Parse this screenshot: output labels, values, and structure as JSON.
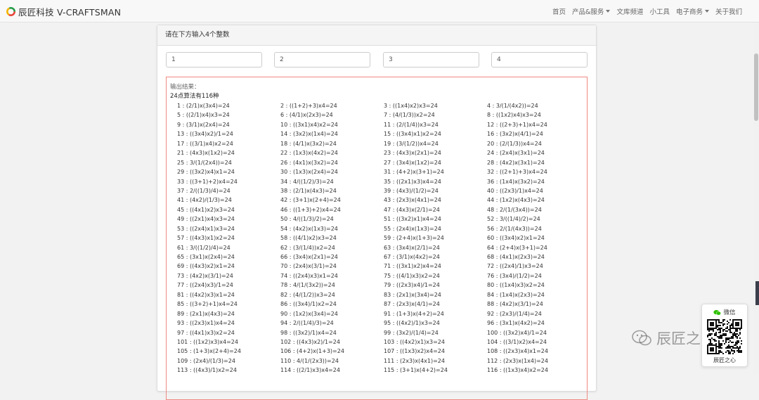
{
  "brand": {
    "title": "辰匠科技 V-CRAFTSMAN"
  },
  "nav": {
    "items": [
      {
        "label": "首页",
        "dropdown": false
      },
      {
        "label": "产品&服务",
        "dropdown": true
      },
      {
        "label": "文库频道",
        "dropdown": false
      },
      {
        "label": "小工具",
        "dropdown": false
      },
      {
        "label": "电子商务",
        "dropdown": true
      },
      {
        "label": "关于我们",
        "dropdown": false
      }
    ]
  },
  "panel": {
    "heading": "请在下方输入4个整数"
  },
  "inputs": {
    "values": [
      "1",
      "2",
      "3",
      "4"
    ]
  },
  "result": {
    "label": "输出结果：",
    "count_text": "24点算法有116种",
    "solutions": [
      "1 : (2/1)x(3x4)=24",
      "2 : ((1+2)+3)x4=24",
      "3 : ((1x4)x2)x3=24",
      "4 : 3/(1/(4x2))=24",
      "5 : ((2/1)x4)x3=24",
      "6 : (4/1)x(2x3)=24",
      "7 : (4/(1/3))x2=24",
      "8 : ((1x2)x4)x3=24",
      "9 : (3/1)x(2x4)=24",
      "10 : ((3x1)x4)x2=24",
      "11 : (2/(1/4))x3=24",
      "12 : ((2+3)+1)x4=24",
      "13 : ((3x4)x2)/1=24",
      "14 : (3x2)x(1x4)=24",
      "15 : ((3x4)x1)x2=24",
      "16 : (3x2)x(4/1)=24",
      "17 : ((3/1)x4)x2=24",
      "18 : (4/1)x(3x2)=24",
      "19 : (3/(1/2))x4=24",
      "20 : (2/(1/3))x4=24",
      "21 : (4x3)x(1x2)=24",
      "22 : (1x3)x(4x2)=24",
      "23 : (4x3)x(2x1)=24",
      "24 : (2x4)x(3x1)=24",
      "25 : 3/(1/(2x4))=24",
      "26 : (4x1)x(3x2)=24",
      "27 : (3x4)x(1x2)=24",
      "28 : (4x2)x(3x1)=24",
      "29 : ((3x2)x4)x1=24",
      "30 : (1x3)x(2x4)=24",
      "31 : (4+2)x(3+1)=24",
      "32 : ((2+1)+3)x4=24",
      "33 : ((3+1)+2)x4=24",
      "34 : 4/((1/2)/3)=24",
      "35 : ((2x1)x3)x4=24",
      "36 : (1x4)x(3x2)=24",
      "37 : 2/((1/3)/4)=24",
      "38 : (2/1)x(4x3)=24",
      "39 : (4x3)/(1/2)=24",
      "40 : ((2x3)/1)x4=24",
      "41 : (4x2)/(1/3)=24",
      "42 : (3+1)x(2+4)=24",
      "43 : (2x3)x(4x1)=24",
      "44 : (1x2)x(4x3)=24",
      "45 : ((4x1)x2)x3=24",
      "46 : ((1+3)+2)x4=24",
      "47 : (4x3)x(2/1)=24",
      "48 : 2/(1/(3x4))=24",
      "49 : ((2x1)x4)x3=24",
      "50 : 4/((1/3)/2)=24",
      "51 : ((3x2)x1)x4=24",
      "52 : 3/((1/4)/2)=24",
      "53 : ((2x4)x1)x3=24",
      "54 : (4x2)x(1x3)=24",
      "55 : (2x4)x(1x3)=24",
      "56 : 2/(1/(4x3))=24",
      "57 : ((4x3)x1)x2=24",
      "58 : ((4/1)x2)x3=24",
      "59 : (2+4)x(1+3)=24",
      "60 : ((3x4)x2)x1=24",
      "61 : 3/((1/2)/4)=24",
      "62 : (3/(1/4))x2=24",
      "63 : (3x4)x(2/1)=24",
      "64 : (2+4)x(3+1)=24",
      "65 : (3x1)x(2x4)=24",
      "66 : (3x4)x(2x1)=24",
      "67 : (3/1)x(4x2)=24",
      "68 : (4x1)x(2x3)=24",
      "69 : ((4x3)x2)x1=24",
      "70 : (2x4)x(3/1)=24",
      "71 : ((3x1)x2)x4=24",
      "72 : ((2x4)/1)x3=24",
      "73 : (4x2)x(3/1)=24",
      "74 : ((2x4)x3)x1=24",
      "75 : ((4/1)x3)x2=24",
      "76 : (3x4)/(1/2)=24",
      "77 : ((2x4)x3)/1=24",
      "78 : 4/(1/(3x2))=24",
      "79 : ((2x3)x4)/1=24",
      "80 : ((1x4)x3)x2=24",
      "81 : ((4x2)x3)x1=24",
      "82 : (4/(1/2))x3=24",
      "83 : (2x1)x(3x4)=24",
      "84 : (1x4)x(2x3)=24",
      "85 : ((3+2)+1)x4=24",
      "86 : ((3x4)/1)x2=24",
      "87 : (2x3)x(4/1)=24",
      "88 : (4x2)x(3/1)=24",
      "89 : (2x1)x(4x3)=24",
      "90 : (1x2)x(3x4)=24",
      "91 : (1+3)x(4+2)=24",
      "92 : (2x3)/(1/4)=24",
      "93 : ((2x3)x1)x4=24",
      "94 : 2/((1/4)/3)=24",
      "95 : ((4x2)/1)x3=24",
      "96 : (3x1)x(4x2)=24",
      "97 : ((4x1)x3)x2=24",
      "98 : ((3x2)/1)x4=24",
      "99 : (3x2)/(1/4)=24",
      "100 : ((3x2)x4)/1=24",
      "101 : ((1x2)x3)x4=24",
      "102 : ((4x3)x2)/1=24",
      "103 : ((4x2)x1)x3=24",
      "104 : ((3/1)x2)x4=24",
      "105 : (1+3)x(2+4)=24",
      "106 : (4+2)x(1+3)=24",
      "107 : ((1x3)x2)x4=24",
      "108 : ((2x3)x4)x1=24",
      "109 : (2x4)/(1/3)=24",
      "110 : 4/(1/(2x3))=24",
      "111 : (2x3)x(4x1)=24",
      "112 : (2x3)x(1x4)=24",
      "113 : ((4x3)/1)x2=24",
      "114 : ((2/1)x3)x4=24",
      "115 : (3+1)x(4+2)=24",
      "116 : ((1x3)x4)x2=24"
    ]
  },
  "wechat": {
    "title": "微信",
    "caption": "辰匠之心"
  },
  "watermark": {
    "text": "辰匠之心"
  }
}
